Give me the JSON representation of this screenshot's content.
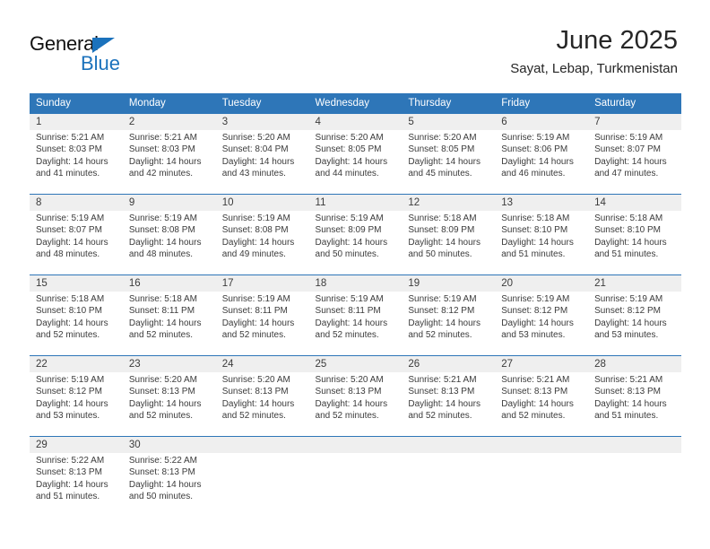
{
  "brand": {
    "word1": "General",
    "word2": "Blue",
    "accent_color": "#1b72bc",
    "logo_icon": "triangle-flag-icon"
  },
  "header": {
    "month_title": "June 2025",
    "location": "Sayat, Lebap, Turkmenistan"
  },
  "calendar": {
    "header_bg": "#2e76b8",
    "daynum_bg": "#efefef",
    "weekday_headers": [
      "Sunday",
      "Monday",
      "Tuesday",
      "Wednesday",
      "Thursday",
      "Friday",
      "Saturday"
    ],
    "weeks": [
      {
        "days": [
          {
            "num": "1",
            "sunrise": "Sunrise: 5:21 AM",
            "sunset": "Sunset: 8:03 PM",
            "daylight": "Daylight: 14 hours and 41 minutes."
          },
          {
            "num": "2",
            "sunrise": "Sunrise: 5:21 AM",
            "sunset": "Sunset: 8:03 PM",
            "daylight": "Daylight: 14 hours and 42 minutes."
          },
          {
            "num": "3",
            "sunrise": "Sunrise: 5:20 AM",
            "sunset": "Sunset: 8:04 PM",
            "daylight": "Daylight: 14 hours and 43 minutes."
          },
          {
            "num": "4",
            "sunrise": "Sunrise: 5:20 AM",
            "sunset": "Sunset: 8:05 PM",
            "daylight": "Daylight: 14 hours and 44 minutes."
          },
          {
            "num": "5",
            "sunrise": "Sunrise: 5:20 AM",
            "sunset": "Sunset: 8:05 PM",
            "daylight": "Daylight: 14 hours and 45 minutes."
          },
          {
            "num": "6",
            "sunrise": "Sunrise: 5:19 AM",
            "sunset": "Sunset: 8:06 PM",
            "daylight": "Daylight: 14 hours and 46 minutes."
          },
          {
            "num": "7",
            "sunrise": "Sunrise: 5:19 AM",
            "sunset": "Sunset: 8:07 PM",
            "daylight": "Daylight: 14 hours and 47 minutes."
          }
        ]
      },
      {
        "days": [
          {
            "num": "8",
            "sunrise": "Sunrise: 5:19 AM",
            "sunset": "Sunset: 8:07 PM",
            "daylight": "Daylight: 14 hours and 48 minutes."
          },
          {
            "num": "9",
            "sunrise": "Sunrise: 5:19 AM",
            "sunset": "Sunset: 8:08 PM",
            "daylight": "Daylight: 14 hours and 48 minutes."
          },
          {
            "num": "10",
            "sunrise": "Sunrise: 5:19 AM",
            "sunset": "Sunset: 8:08 PM",
            "daylight": "Daylight: 14 hours and 49 minutes."
          },
          {
            "num": "11",
            "sunrise": "Sunrise: 5:19 AM",
            "sunset": "Sunset: 8:09 PM",
            "daylight": "Daylight: 14 hours and 50 minutes."
          },
          {
            "num": "12",
            "sunrise": "Sunrise: 5:18 AM",
            "sunset": "Sunset: 8:09 PM",
            "daylight": "Daylight: 14 hours and 50 minutes."
          },
          {
            "num": "13",
            "sunrise": "Sunrise: 5:18 AM",
            "sunset": "Sunset: 8:10 PM",
            "daylight": "Daylight: 14 hours and 51 minutes."
          },
          {
            "num": "14",
            "sunrise": "Sunrise: 5:18 AM",
            "sunset": "Sunset: 8:10 PM",
            "daylight": "Daylight: 14 hours and 51 minutes."
          }
        ]
      },
      {
        "days": [
          {
            "num": "15",
            "sunrise": "Sunrise: 5:18 AM",
            "sunset": "Sunset: 8:10 PM",
            "daylight": "Daylight: 14 hours and 52 minutes."
          },
          {
            "num": "16",
            "sunrise": "Sunrise: 5:18 AM",
            "sunset": "Sunset: 8:11 PM",
            "daylight": "Daylight: 14 hours and 52 minutes."
          },
          {
            "num": "17",
            "sunrise": "Sunrise: 5:19 AM",
            "sunset": "Sunset: 8:11 PM",
            "daylight": "Daylight: 14 hours and 52 minutes."
          },
          {
            "num": "18",
            "sunrise": "Sunrise: 5:19 AM",
            "sunset": "Sunset: 8:11 PM",
            "daylight": "Daylight: 14 hours and 52 minutes."
          },
          {
            "num": "19",
            "sunrise": "Sunrise: 5:19 AM",
            "sunset": "Sunset: 8:12 PM",
            "daylight": "Daylight: 14 hours and 52 minutes."
          },
          {
            "num": "20",
            "sunrise": "Sunrise: 5:19 AM",
            "sunset": "Sunset: 8:12 PM",
            "daylight": "Daylight: 14 hours and 53 minutes."
          },
          {
            "num": "21",
            "sunrise": "Sunrise: 5:19 AM",
            "sunset": "Sunset: 8:12 PM",
            "daylight": "Daylight: 14 hours and 53 minutes."
          }
        ]
      },
      {
        "days": [
          {
            "num": "22",
            "sunrise": "Sunrise: 5:19 AM",
            "sunset": "Sunset: 8:12 PM",
            "daylight": "Daylight: 14 hours and 53 minutes."
          },
          {
            "num": "23",
            "sunrise": "Sunrise: 5:20 AM",
            "sunset": "Sunset: 8:13 PM",
            "daylight": "Daylight: 14 hours and 52 minutes."
          },
          {
            "num": "24",
            "sunrise": "Sunrise: 5:20 AM",
            "sunset": "Sunset: 8:13 PM",
            "daylight": "Daylight: 14 hours and 52 minutes."
          },
          {
            "num": "25",
            "sunrise": "Sunrise: 5:20 AM",
            "sunset": "Sunset: 8:13 PM",
            "daylight": "Daylight: 14 hours and 52 minutes."
          },
          {
            "num": "26",
            "sunrise": "Sunrise: 5:21 AM",
            "sunset": "Sunset: 8:13 PM",
            "daylight": "Daylight: 14 hours and 52 minutes."
          },
          {
            "num": "27",
            "sunrise": "Sunrise: 5:21 AM",
            "sunset": "Sunset: 8:13 PM",
            "daylight": "Daylight: 14 hours and 52 minutes."
          },
          {
            "num": "28",
            "sunrise": "Sunrise: 5:21 AM",
            "sunset": "Sunset: 8:13 PM",
            "daylight": "Daylight: 14 hours and 51 minutes."
          }
        ]
      },
      {
        "days": [
          {
            "num": "29",
            "sunrise": "Sunrise: 5:22 AM",
            "sunset": "Sunset: 8:13 PM",
            "daylight": "Daylight: 14 hours and 51 minutes."
          },
          {
            "num": "30",
            "sunrise": "Sunrise: 5:22 AM",
            "sunset": "Sunset: 8:13 PM",
            "daylight": "Daylight: 14 hours and 50 minutes."
          },
          {
            "num": "",
            "sunrise": "",
            "sunset": "",
            "daylight": ""
          },
          {
            "num": "",
            "sunrise": "",
            "sunset": "",
            "daylight": ""
          },
          {
            "num": "",
            "sunrise": "",
            "sunset": "",
            "daylight": ""
          },
          {
            "num": "",
            "sunrise": "",
            "sunset": "",
            "daylight": ""
          },
          {
            "num": "",
            "sunrise": "",
            "sunset": "",
            "daylight": ""
          }
        ]
      }
    ]
  }
}
